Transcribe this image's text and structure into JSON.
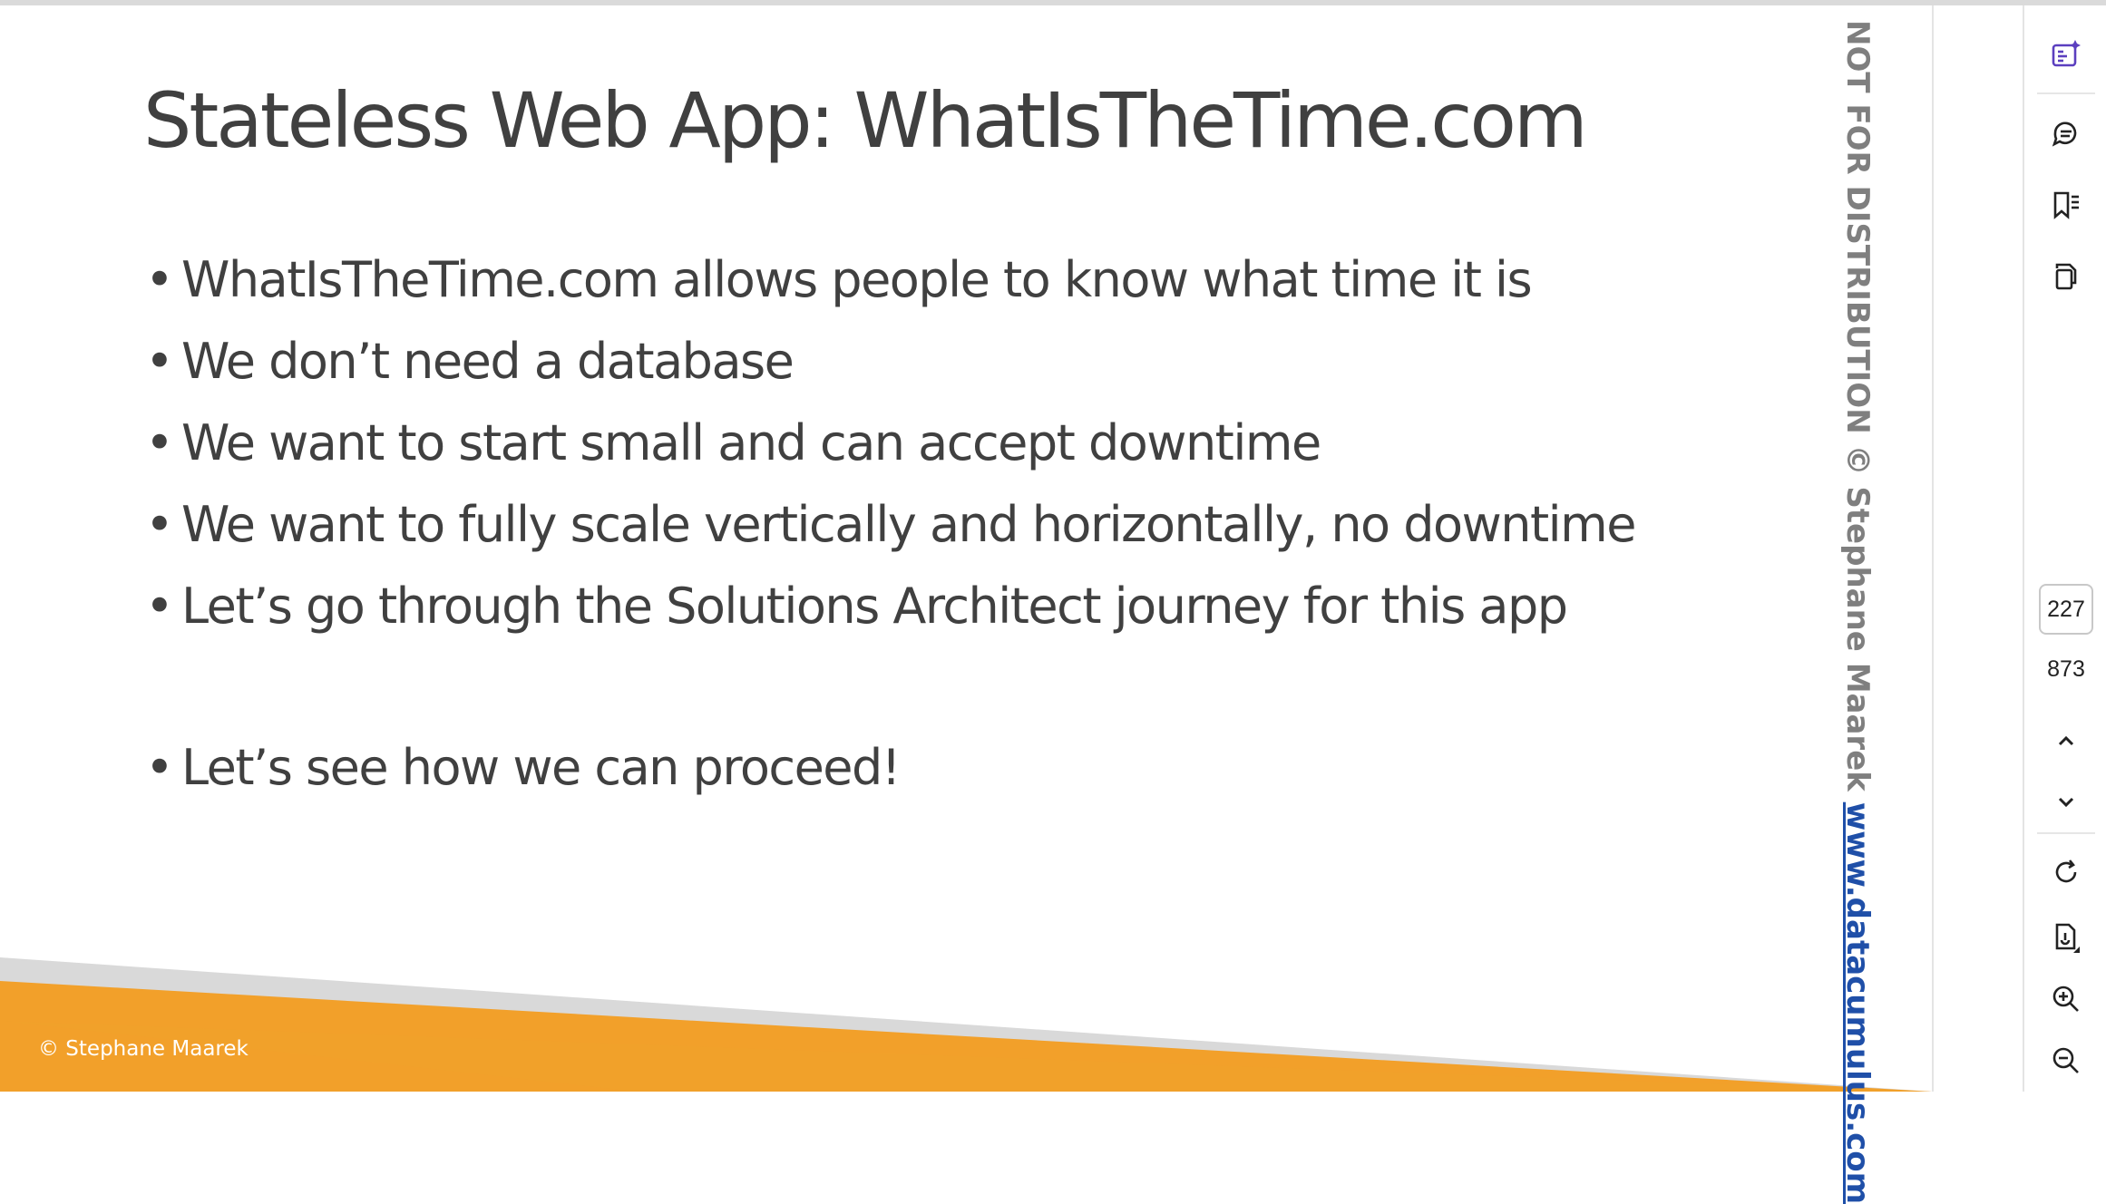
{
  "slide": {
    "title": "Stateless Web App: WhatIsTheTime.com",
    "bullets": [
      "WhatIsTheTime.com allows people to know what time it is",
      "We don’t need a database",
      "We want to start small and can accept downtime",
      "We want to fully scale vertically and horizontally, no downtime",
      "Let’s go through the Solutions Architect journey for this app",
      "Let’s see how we can proceed!"
    ],
    "bullet_symbol": "•",
    "footer_copyright": "© Stephane Maarek",
    "watermark_text": "NOT FOR DISTRIBUTION © Stephane Maarek ",
    "watermark_link": "www.datacumulus.com"
  },
  "viewer": {
    "current_page": "227",
    "total_pages": "873",
    "icons": {
      "ai": "ai-assistant-icon",
      "comment": "comment-icon",
      "bookmark": "bookmark-icon",
      "pages": "page-thumbnails-icon",
      "prev": "chevron-up-icon",
      "next": "chevron-down-icon",
      "rotate": "rotate-icon",
      "extract": "extract-page-icon",
      "zoom_in": "zoom-in-icon",
      "zoom_out": "zoom-out-icon"
    }
  },
  "colors": {
    "title_text": "#404040",
    "footer_orange": "#f2a02a",
    "footer_grey": "#d9d9d9",
    "watermark_grey": "#7f7f7f",
    "link_blue": "#1f4fa8",
    "accent_purple": "#5b3fbf"
  }
}
